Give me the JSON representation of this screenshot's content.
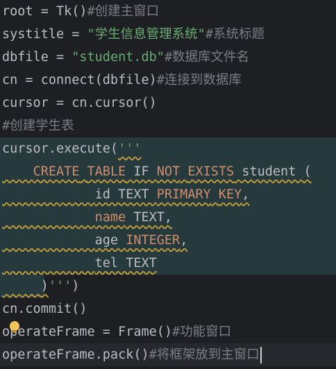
{
  "code": {
    "l1": {
      "a": "root = Tk()",
      "c": "#创建主窗口"
    },
    "l2": {
      "a": "systitle = ",
      "s": "\"学生信息管理系统\"",
      "c": "#系统标题"
    },
    "l3": {
      "a": "dbfile = ",
      "s": "\"student.db\"",
      "c": "#数据库文件名"
    },
    "l4": {
      "a": "cn = connect(dbfile)",
      "c": "#连接到数据库"
    },
    "l5": {
      "a": "cursor = cn.cursor()"
    },
    "l6": {
      "c": "#创建学生表"
    },
    "l7": {
      "a": "cursor.execute(",
      "s": "'''"
    },
    "l8": {
      "i": "    ",
      "k1": "CREATE",
      "sp1": " ",
      "k2": "TABLE",
      "p1": " IF ",
      "k3": "NOT",
      "sp2": " ",
      "k4": "EXISTS",
      "p2": " student ("
    },
    "l9": {
      "i": "            ",
      "p1": "id TEXT ",
      "k1": "PRIMARY",
      "sp": " ",
      "k2": "KEY",
      "p2": ","
    },
    "l10": {
      "i": "            ",
      "k1": "name",
      "p1": " TEXT,"
    },
    "l11": {
      "i": "            ",
      "p1": "age ",
      "k1": "INTEGER",
      "p2": ","
    },
    "l12": {
      "i": "            ",
      "p1": "tel TEXT"
    },
    "l13": {
      "i": "     ",
      "p1": ")",
      "s": "'''",
      "a": ")"
    },
    "l14": {
      "a": "cn.commit()"
    },
    "l15": {
      "a": "operateFrame = Frame()",
      "c": "#功能窗口"
    },
    "l16": {
      "a": "operateFrame.pack()",
      "c": "#将框架放到主窗口"
    }
  },
  "colors": {
    "background": "#1e1f22",
    "text": "#bcbec4",
    "string": "#6aab73",
    "keyword": "#cf8e6d",
    "comment": "#7a7e85",
    "highlight": "#26393d"
  },
  "icons": {
    "intention": "lightbulb-icon"
  }
}
